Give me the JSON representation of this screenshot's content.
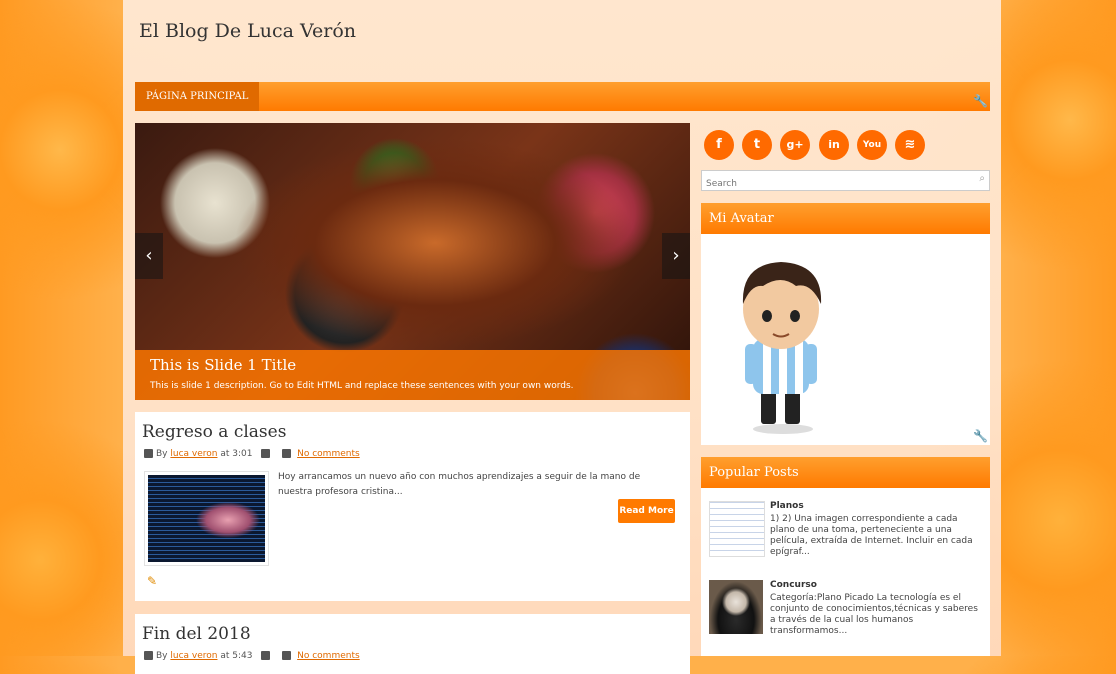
{
  "blog": {
    "title": "El Blog De Luca Verón"
  },
  "nav": {
    "items": [
      "PÁGINA PRINCIPAL"
    ]
  },
  "slider": {
    "title": "This is Slide 1 Title",
    "description": "This is slide 1 description. Go to Edit HTML and replace these sentences with your own words.",
    "prev_icon": "‹",
    "next_icon": "›"
  },
  "posts": [
    {
      "title": "Regreso a clases",
      "by": "By",
      "author": "luca veron",
      "at": "at 3:01",
      "comments": "No comments",
      "excerpt": "Hoy arrancamos un nuevo año con muchos aprendizajes a seguir de la mano de nuestra profesora cristina...",
      "read_more": "Read More"
    },
    {
      "title": "Fin del 2018",
      "by": "By",
      "author": "luca veron",
      "at": "at 5:43",
      "comments": "No comments"
    }
  ],
  "social": [
    {
      "name": "facebook",
      "glyph": "f"
    },
    {
      "name": "twitter",
      "glyph": "t"
    },
    {
      "name": "google-plus",
      "glyph": "g+"
    },
    {
      "name": "linkedin",
      "glyph": "in"
    },
    {
      "name": "youtube",
      "glyph": "You"
    },
    {
      "name": "rss",
      "glyph": "≋"
    }
  ],
  "search": {
    "placeholder": "Search"
  },
  "widgets": {
    "avatar": {
      "title": "Mi Avatar"
    },
    "popular": {
      "title": "Popular Posts",
      "items": [
        {
          "title": "Planos",
          "text": "1) 2) Una imagen correspondiente a cada plano de una toma, perteneciente a una película, extraída de Internet. Incluir en cada epígraf..."
        },
        {
          "title": "Concurso",
          "text": "Categoría:Plano Picado La tecnología es el conjunto de conocimientos,técnicas y saberes a través de la cual los humanos transformamos..."
        }
      ]
    }
  },
  "colors": {
    "accent": "#ff7a00",
    "accent_dark": "#e06a00",
    "link": "#e06a00"
  }
}
